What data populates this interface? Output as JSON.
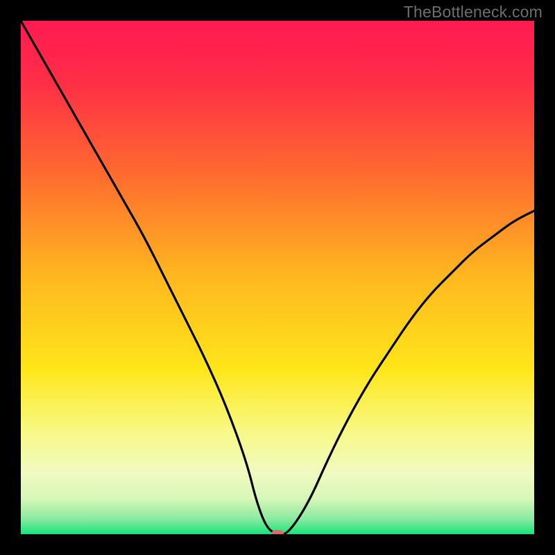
{
  "watermark": "TheBottleneck.com",
  "chart_data": {
    "type": "line",
    "title": "",
    "xlabel": "",
    "ylabel": "",
    "xlim": [
      0,
      100
    ],
    "ylim": [
      0,
      100
    ],
    "grid": false,
    "legend": false,
    "gradient_stops": [
      {
        "pct": 0,
        "color": "#ff1a52"
      },
      {
        "pct": 12,
        "color": "#ff2e47"
      },
      {
        "pct": 30,
        "color": "#ff6b2f"
      },
      {
        "pct": 50,
        "color": "#ffb81f"
      },
      {
        "pct": 68,
        "color": "#ffe61a"
      },
      {
        "pct": 80,
        "color": "#f8f986"
      },
      {
        "pct": 88,
        "color": "#f0fac0"
      },
      {
        "pct": 93,
        "color": "#d7f7b8"
      },
      {
        "pct": 97,
        "color": "#8ceaa0"
      },
      {
        "pct": 100,
        "color": "#18e37a"
      }
    ],
    "series": [
      {
        "name": "bottleneck-curve",
        "color": "#000000",
        "x": [
          0,
          4,
          8,
          12,
          16,
          20,
          24,
          28,
          32,
          36,
          40,
          44,
          46,
          48,
          50,
          52,
          56,
          60,
          64,
          68,
          72,
          76,
          80,
          84,
          88,
          92,
          96,
          100
        ],
        "y": [
          100,
          93,
          86,
          79,
          72,
          65,
          58,
          50,
          42,
          34,
          25,
          14,
          6,
          1,
          0,
          0,
          6,
          15,
          23,
          30,
          36,
          42,
          47,
          51,
          55,
          58,
          61,
          63
        ]
      }
    ],
    "marker": {
      "x": 50,
      "y": 0,
      "color": "#d96d62"
    }
  }
}
